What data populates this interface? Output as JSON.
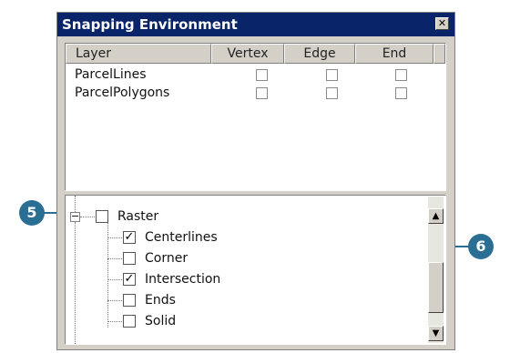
{
  "window": {
    "title": "Snapping Environment",
    "close_glyph": "✕"
  },
  "layer_table": {
    "columns": [
      "Layer",
      "Vertex",
      "Edge",
      "End"
    ],
    "rows": [
      {
        "name": "ParcelLines",
        "vertex": false,
        "edge": false,
        "end": false
      },
      {
        "name": "ParcelPolygons",
        "vertex": false,
        "edge": false,
        "end": false
      }
    ]
  },
  "tree": {
    "root": {
      "label": "Raster",
      "checked": false,
      "expander": "−"
    },
    "children": [
      {
        "label": "Centerlines",
        "checked": true
      },
      {
        "label": "Corner",
        "checked": false
      },
      {
        "label": "Intersection",
        "checked": true
      },
      {
        "label": "Ends",
        "checked": false
      },
      {
        "label": "Solid",
        "checked": false
      }
    ],
    "check_glyph": "✓"
  },
  "scrollbar": {
    "up_glyph": "▲",
    "down_glyph": "▼"
  },
  "callouts": {
    "left": "5",
    "right": "6"
  },
  "colors": {
    "title_bar": "#0a246a",
    "callout": "#2a6e94",
    "panel": "#d4d0c8"
  }
}
